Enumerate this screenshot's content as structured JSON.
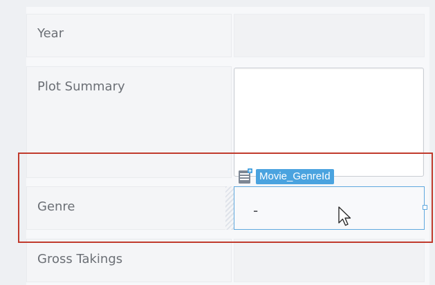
{
  "form": {
    "year_label": "Year",
    "plot_summary_label": "Plot Summary",
    "genre_label": "Genre",
    "gross_takings_label": "Gross Takings",
    "genre_value": "-",
    "plot_summary_value": ""
  },
  "binding": {
    "field_name": "Movie_GenreId",
    "icon": "table-icon"
  },
  "colors": {
    "selection_outline": "#c0392b",
    "binding_tag": "#4aa3df",
    "focus_border": "#5ea8de"
  }
}
